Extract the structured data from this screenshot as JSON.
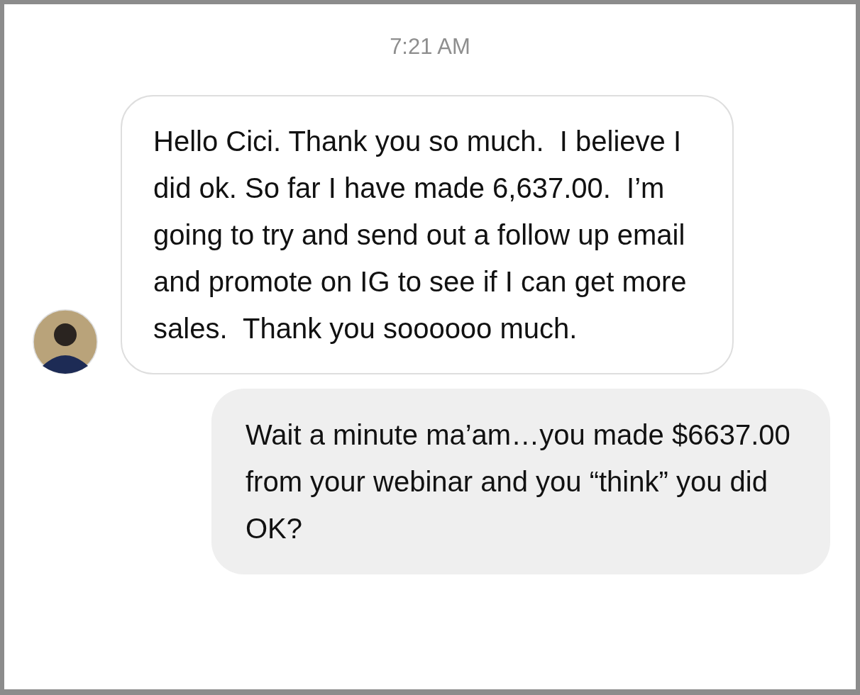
{
  "timestamp": "7:21 AM",
  "messages": [
    {
      "kind": "received",
      "text": "Hello Cici. Thank you so much.  I believe I did ok. So far I have made 6,637.00.  I’m going to try and send out a follow up email and promote on IG to see if I can get more sales.  Thank you soooooo much."
    },
    {
      "kind": "sent",
      "text": "Wait a minute ma’am…you made $6637.00 from your webinar and you “think” you did OK?"
    }
  ]
}
